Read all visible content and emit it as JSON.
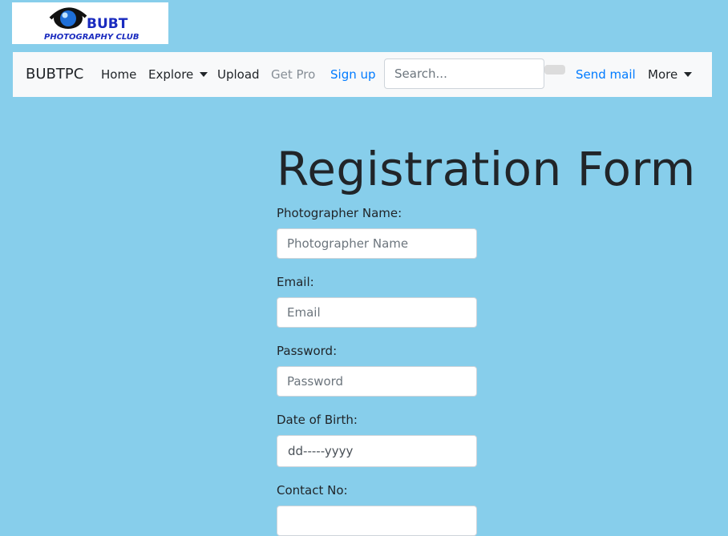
{
  "logo": {
    "line1": "BUBT",
    "line2": "PHOTOGRAPHY CLUB",
    "colors": {
      "text": "#1a2bbf",
      "eye": "#1e6fd8"
    }
  },
  "navbar": {
    "brand": "BUBTPC",
    "items": {
      "home": "Home",
      "explore": "Explore",
      "upload": "Upload",
      "get_pro": "Get Pro",
      "sign_up": "Sign up",
      "send_mail": "Send mail",
      "more": "More"
    },
    "search_placeholder": "Search..."
  },
  "form": {
    "title": "Registration Form",
    "fields": [
      {
        "label": "Photographer Name:",
        "placeholder": "Photographer Name"
      },
      {
        "label": "Email:",
        "placeholder": "Email"
      },
      {
        "label": "Password:",
        "placeholder": "Password"
      },
      {
        "label": "Date of Birth:",
        "placeholder": "dd-----yyyy"
      },
      {
        "label": "Contact No:",
        "placeholder": ""
      }
    ]
  },
  "colors": {
    "background": "#87ceeb",
    "navbar_bg": "#f8f9fa",
    "link": "#007bff",
    "muted": "#868e96"
  }
}
